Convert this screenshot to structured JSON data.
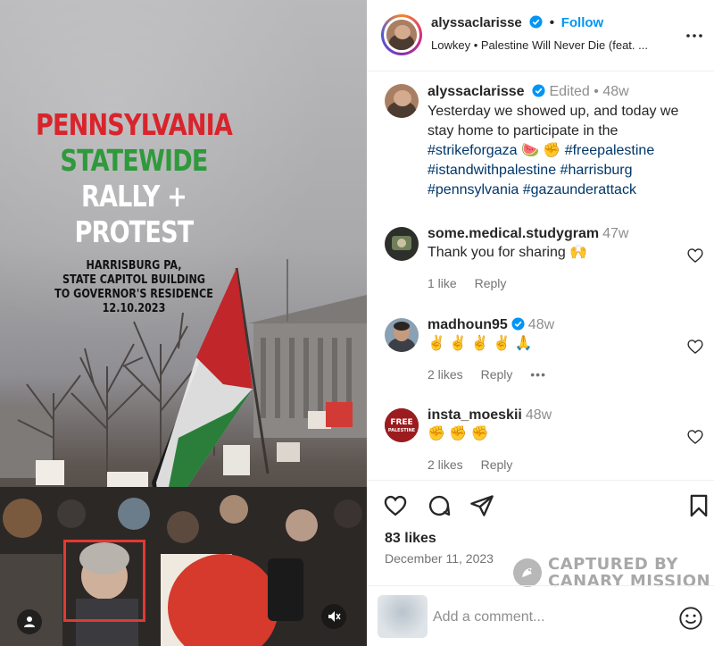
{
  "post": {
    "poster": {
      "line1": "PENNSYLVANIA",
      "line2": "STATEWIDE",
      "line3": "RALLY + PROTEST",
      "details": [
        "HARRISBURG PA,",
        "STATE CAPITOL BUILDING",
        "TO GOVERNOR'S RESIDENCE",
        "12.10.2023"
      ]
    }
  },
  "header": {
    "username": "alyssaclarisse",
    "separator": "•",
    "follow_label": "Follow",
    "song": "Lowkey • Palestine Will Never Die (feat. ..."
  },
  "caption": {
    "username": "alyssaclarisse",
    "edited": "Edited",
    "dot": "•",
    "time": "48w",
    "text_plain": "Yesterday we showed up, and today we stay home to participate in the",
    "tag1": "#strikeforgaza",
    "emoji": "🍉 ✊",
    "tags_rest": "#freepalestine #istandwithpalestine #harrisburg #pennsylvania #gazaunderattack"
  },
  "comments": [
    {
      "username": "some.medical.studygram",
      "time": "47w",
      "text": "Thank you for sharing 🙌",
      "likes": "1 like",
      "reply": "Reply"
    },
    {
      "username": "madhoun95",
      "time": "48w",
      "text": "✌ ✌ ✌ ✌ 🙏",
      "likes": "2 likes",
      "reply": "Reply",
      "more": "•••"
    },
    {
      "username": "insta_moeskii",
      "time": "48w",
      "text": "✊ ✊ ✊",
      "likes": "2 likes",
      "reply": "Reply",
      "avatar_text": "FREE\nPALESTINE"
    }
  ],
  "footer": {
    "likes": "83 likes",
    "date": "December 11, 2023",
    "add_comment_placeholder": "Add a comment..."
  },
  "watermark": {
    "line1": "CAPTURED BY",
    "line2": "CANARY MISSION"
  },
  "colors": {
    "link": "#0095f6",
    "hashtag": "#00376b",
    "muted": "#8e8e8e",
    "highlight_box": "#e03a32"
  }
}
